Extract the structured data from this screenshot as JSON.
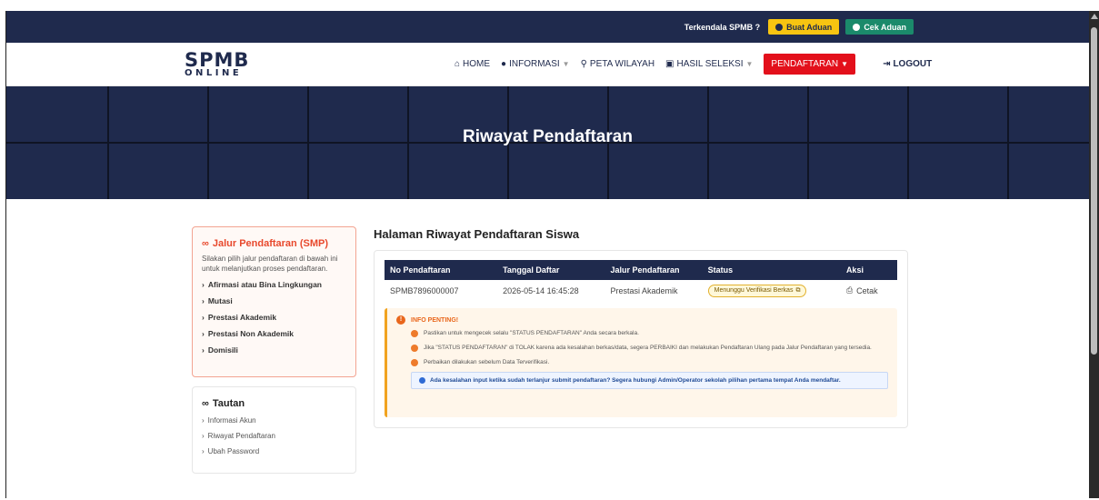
{
  "topbar": {
    "trouble_label": "Terkendala SPMB ?",
    "buat_aduan": "Buat Aduan",
    "cek_aduan": "Cek Aduan"
  },
  "logo": {
    "line1": "SPMB",
    "line2": "ONLINE"
  },
  "nav": {
    "home": "HOME",
    "informasi": "INFORMASI",
    "peta": "PETA WILAYAH",
    "hasil": "HASIL SELEKSI",
    "pendaftaran": "PENDAFTARAN",
    "logout": "LOGOUT"
  },
  "hero": {
    "title": "Riwayat Pendaftaran"
  },
  "jalur": {
    "title": "Jalur Pendaftaran (SMP)",
    "description": "Silakan pilih jalur pendaftaran di bawah ini untuk melanjutkan proses pendaftaran.",
    "items": [
      "Afirmasi atau Bina Lingkungan",
      "Mutasi",
      "Prestasi Akademik",
      "Prestasi Non Akademik",
      "Domisili"
    ]
  },
  "tautan": {
    "title": "Tautan",
    "items": [
      "Informasi Akun",
      "Riwayat Pendaftaran",
      "Ubah Password"
    ]
  },
  "main": {
    "title": "Halaman Riwayat Pendaftaran Siswa",
    "columns": [
      "No Pendaftaran",
      "Tanggal Daftar",
      "Jalur Pendaftaran",
      "Status",
      "Aksi"
    ],
    "row": {
      "no": "SPMB7896000007",
      "tanggal": "2026-05-14 16:45:28",
      "jalur": "Prestasi Akademik",
      "status": "Menunggu Verifikasi Berkas",
      "aksi": "Cetak"
    }
  },
  "info": {
    "head": "INFO PENTING!",
    "items": [
      "Pastikan untuk mengecek selalu \"STATUS PENDAFTARAN\" Anda secara berkala.",
      "Jika \"STATUS PENDAFTARAN\" di TOLAK karena ada kesalahan berkas/data, segera PERBAIKI dan melakukan Pendaftaran Ulang pada Jalur Pendaftaran yang tersedia.",
      "Perbaikan dilakukan sebelum Data Terverifikasi."
    ],
    "note": "Ada kesalahan input ketika sudah terlanjur submit pendaftaran? Segera hubungi Admin/Operator sekolah pilihan pertama tempat Anda mendaftar."
  },
  "colors": {
    "navy": "#1f2a4d",
    "red": "#e3101b",
    "yellow": "#f7c411",
    "green": "#1b8a6b",
    "orange": "#e8482c"
  }
}
